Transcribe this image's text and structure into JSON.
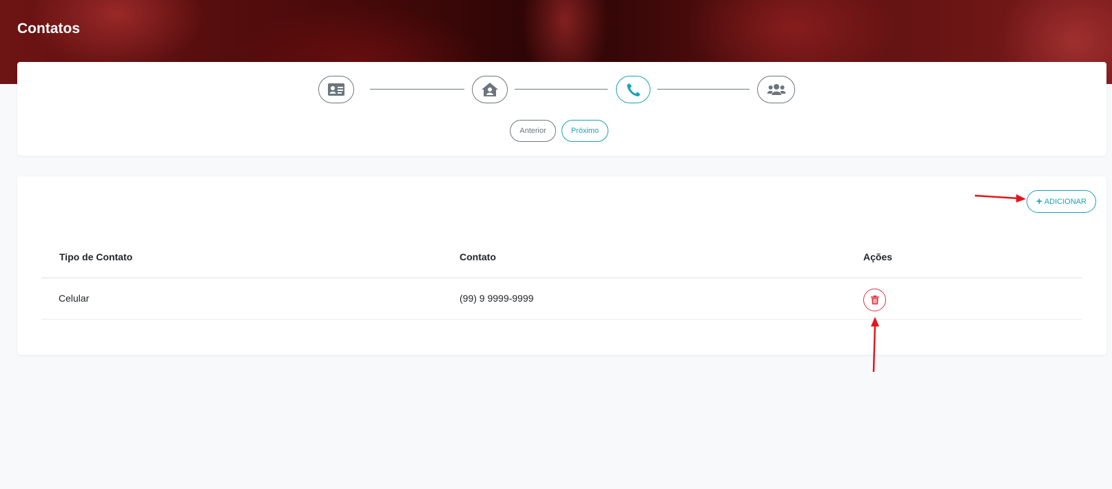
{
  "header": {
    "title": "Contatos"
  },
  "stepper": {
    "steps": [
      {
        "icon": "id-card-icon",
        "state": "default"
      },
      {
        "icon": "house-user-icon",
        "state": "default"
      },
      {
        "icon": "phone-icon",
        "state": "active"
      },
      {
        "icon": "users-icon",
        "state": "default"
      }
    ],
    "prev_label": "Anterior",
    "next_label": "Próximo"
  },
  "contacts": {
    "add_label": "ADICIONAR",
    "columns": [
      "Tipo de Contato",
      "Contato",
      "Ações"
    ],
    "rows": [
      {
        "tipo": "Celular",
        "contato": "(99) 9 9999-9999"
      }
    ]
  },
  "colors": {
    "accent": "#17a2b8",
    "danger": "#dc3545",
    "muted": "#6c757d",
    "annotation": "#e8141b"
  }
}
